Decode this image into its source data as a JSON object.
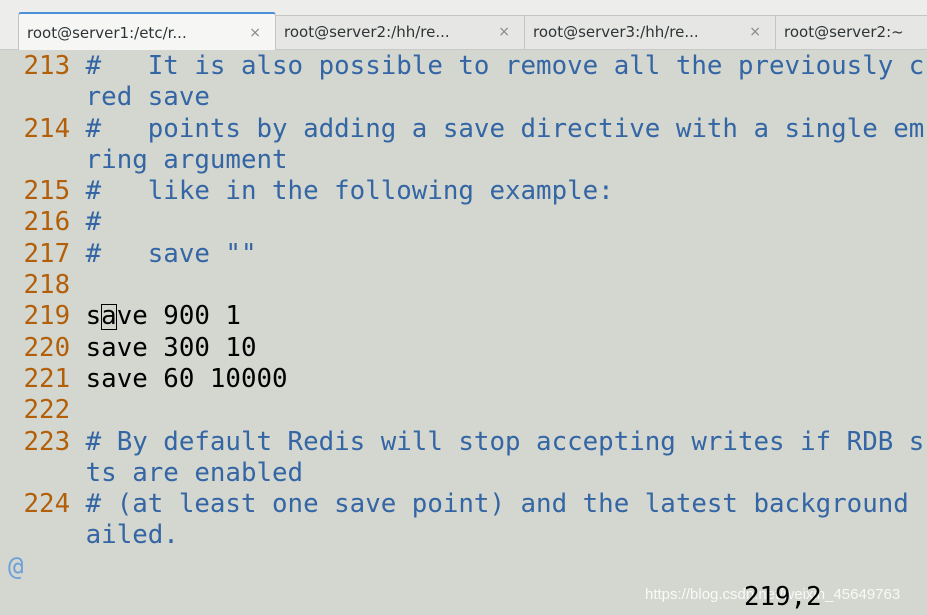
{
  "tabs": [
    {
      "title": "root@server1:/etc/r...",
      "active": true
    },
    {
      "title": "root@server2:/hh/re...",
      "active": false
    },
    {
      "title": "root@server3:/hh/re...",
      "active": false
    },
    {
      "title": "root@server2:~",
      "active": false
    }
  ],
  "close_glyph": "×",
  "lines": [
    {
      "num": "213",
      "text": "#   It is also possible to remove all the previously c",
      "type": "comment"
    },
    {
      "num": "",
      "text": "red save",
      "type": "comment"
    },
    {
      "num": "214",
      "text": "#   points by adding a save directive with a single em",
      "type": "comment"
    },
    {
      "num": "",
      "text": "ring argument",
      "type": "comment"
    },
    {
      "num": "215",
      "text": "#   like in the following example:",
      "type": "comment"
    },
    {
      "num": "216",
      "text": "#",
      "type": "comment"
    },
    {
      "num": "217",
      "text": "#   save \"\"",
      "type": "comment"
    },
    {
      "num": "218",
      "text": "",
      "type": "code"
    },
    {
      "num": "219",
      "text": "save 900 1",
      "type": "code",
      "cursor_col": 2
    },
    {
      "num": "220",
      "text": "save 300 10",
      "type": "code"
    },
    {
      "num": "221",
      "text": "save 60 10000",
      "type": "code"
    },
    {
      "num": "222",
      "text": "",
      "type": "code"
    },
    {
      "num": "223",
      "text": "# By default Redis will stop accepting writes if RDB s",
      "type": "comment"
    },
    {
      "num": "",
      "text": "ts are enabled",
      "type": "comment"
    },
    {
      "num": "224",
      "text": "# (at least one save point) and the latest background ",
      "type": "comment"
    },
    {
      "num": "",
      "text": "ailed.",
      "type": "comment"
    }
  ],
  "continuation_marker": "@",
  "status": {
    "position": "219,2"
  },
  "watermark": "https://blog.csdn.net/weixin_45649763",
  "colors": {
    "line_number": "#b35f0a",
    "comment": "#3465a4",
    "background": "#d3d7cf"
  }
}
